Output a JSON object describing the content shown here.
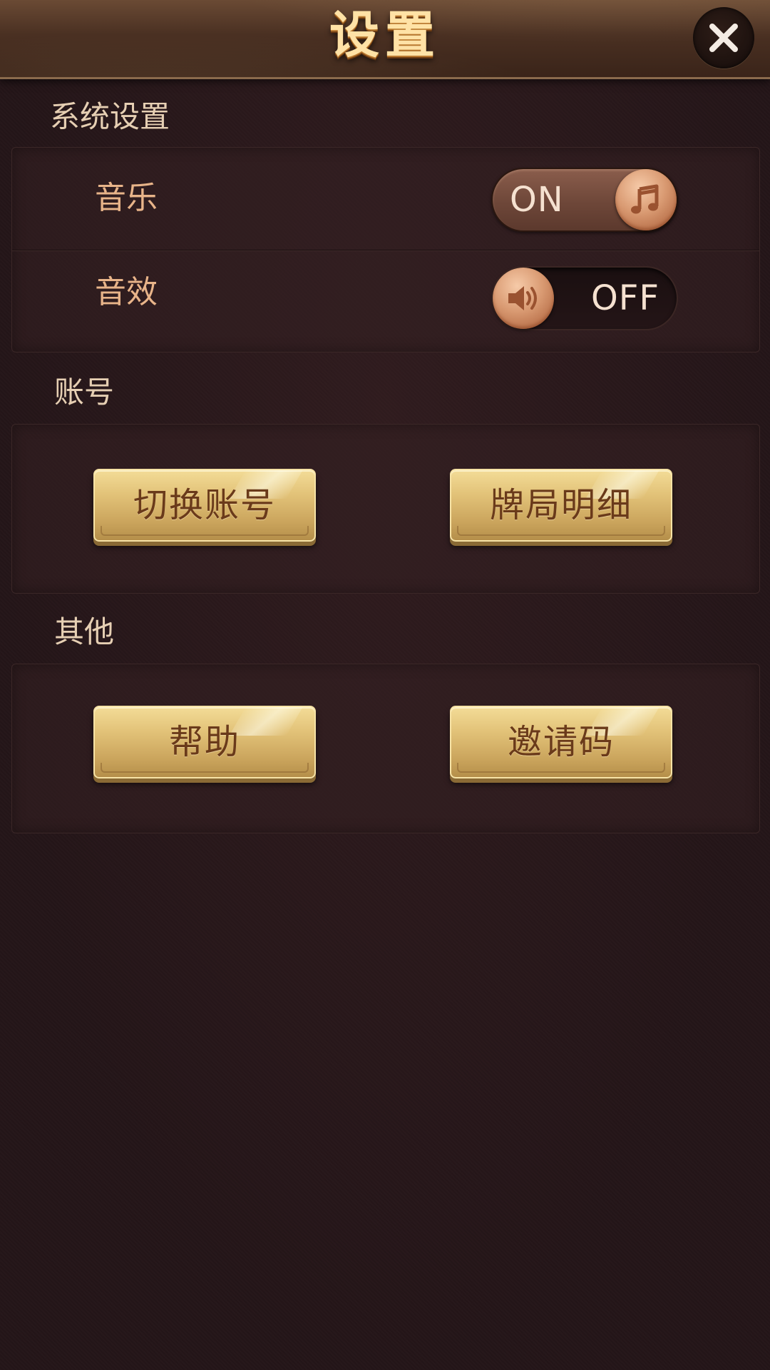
{
  "header": {
    "title": "设置",
    "close_icon": "close-icon"
  },
  "system_settings": {
    "label": "系统设置",
    "music": {
      "label": "音乐",
      "toggle_state": "ON",
      "knob_icon": "music-note-icon"
    },
    "sound_effects": {
      "label": "音效",
      "toggle_state": "OFF",
      "knob_icon": "speaker-icon"
    }
  },
  "account": {
    "label": "账号",
    "switch_account_label": "切换账号",
    "game_records_label": "牌局明细"
  },
  "other": {
    "label": "其他",
    "help_label": "帮助",
    "invite_code_label": "邀请码"
  },
  "colors": {
    "background": "#241518",
    "header_title": "#ffe2a6",
    "row_label": "#e8b489",
    "section_label": "#e6cfb3",
    "gold_button": "#e2c278",
    "gold_button_text": "#6a3a1a"
  }
}
